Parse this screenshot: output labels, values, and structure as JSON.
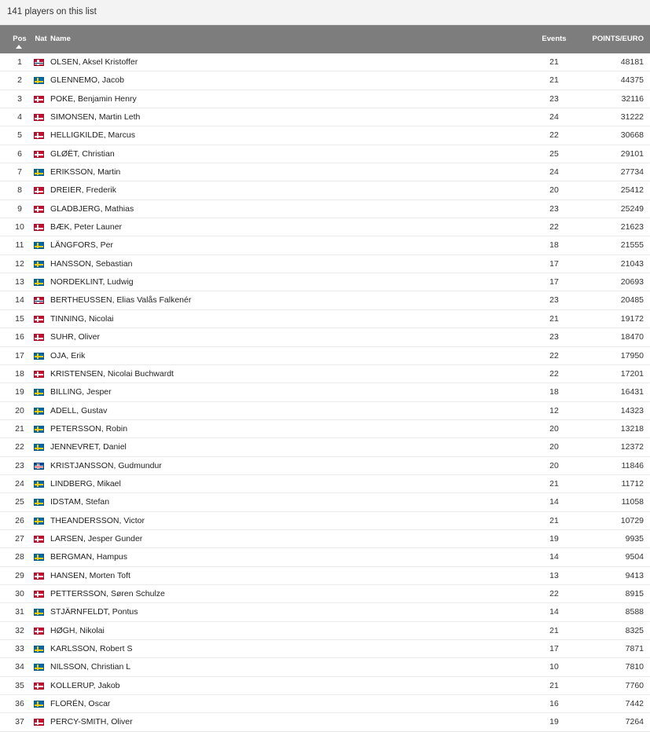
{
  "summary": "141 players on this list",
  "columns": {
    "pos": "Pos",
    "nat": "Nat",
    "name": "Name",
    "events": "Events",
    "points": "POINTS/EURO"
  },
  "sort": {
    "column": "pos",
    "direction": "ascending"
  },
  "flag_icons": {
    "DK": "denmark-flag-icon",
    "SE": "sweden-flag-icon",
    "NO": "norway-flag-icon",
    "IS": "iceland-flag-icon"
  },
  "rows": [
    {
      "pos": "1",
      "nat": "NO",
      "name": "OLSEN, Aksel Kristoffer",
      "events": "21",
      "points": "48181"
    },
    {
      "pos": "2",
      "nat": "SE",
      "name": "GLENNEMO, Jacob",
      "events": "21",
      "points": "44375"
    },
    {
      "pos": "3",
      "nat": "DK",
      "name": "POKE, Benjamin Henry",
      "events": "23",
      "points": "32116"
    },
    {
      "pos": "4",
      "nat": "DK",
      "name": "SIMONSEN, Martin Leth",
      "events": "24",
      "points": "31222"
    },
    {
      "pos": "5",
      "nat": "DK",
      "name": "HELLIGKILDE, Marcus",
      "events": "22",
      "points": "30668"
    },
    {
      "pos": "6",
      "nat": "DK",
      "name": "GLØËT, Christian",
      "events": "25",
      "points": "29101"
    },
    {
      "pos": "7",
      "nat": "SE",
      "name": "ERIKSSON, Martin",
      "events": "24",
      "points": "27734"
    },
    {
      "pos": "8",
      "nat": "DK",
      "name": "DREIER, Frederik",
      "events": "20",
      "points": "25412"
    },
    {
      "pos": "9",
      "nat": "DK",
      "name": "GLADBJERG, Mathias",
      "events": "23",
      "points": "25249"
    },
    {
      "pos": "10",
      "nat": "DK",
      "name": "BÆK, Peter Launer",
      "events": "22",
      "points": "21623"
    },
    {
      "pos": "11",
      "nat": "SE",
      "name": "LÄNGFORS, Per",
      "events": "18",
      "points": "21555"
    },
    {
      "pos": "12",
      "nat": "SE",
      "name": "HANSSON, Sebastian",
      "events": "17",
      "points": "21043"
    },
    {
      "pos": "13",
      "nat": "SE",
      "name": "NORDEKLINT, Ludwig",
      "events": "17",
      "points": "20693"
    },
    {
      "pos": "14",
      "nat": "NO",
      "name": "BERTHEUSSEN, Elias Valås Falkenér",
      "events": "23",
      "points": "20485"
    },
    {
      "pos": "15",
      "nat": "DK",
      "name": "TINNING, Nicolai",
      "events": "21",
      "points": "19172"
    },
    {
      "pos": "16",
      "nat": "DK",
      "name": "SUHR, Oliver",
      "events": "23",
      "points": "18470"
    },
    {
      "pos": "17",
      "nat": "SE",
      "name": "OJA, Erik",
      "events": "22",
      "points": "17950"
    },
    {
      "pos": "18",
      "nat": "DK",
      "name": "KRISTENSEN, Nicolai Buchwardt",
      "events": "22",
      "points": "17201"
    },
    {
      "pos": "19",
      "nat": "SE",
      "name": "BILLING, Jesper",
      "events": "18",
      "points": "16431"
    },
    {
      "pos": "20",
      "nat": "SE",
      "name": "ADELL, Gustav",
      "events": "12",
      "points": "14323"
    },
    {
      "pos": "21",
      "nat": "SE",
      "name": "PETERSSON, Robin",
      "events": "20",
      "points": "13218"
    },
    {
      "pos": "22",
      "nat": "SE",
      "name": "JENNEVRET, Daniel",
      "events": "20",
      "points": "12372"
    },
    {
      "pos": "23",
      "nat": "IS",
      "name": "KRISTJANSSON, Gudmundur",
      "events": "20",
      "points": "11846"
    },
    {
      "pos": "24",
      "nat": "SE",
      "name": "LINDBERG, Mikael",
      "events": "21",
      "points": "11712"
    },
    {
      "pos": "25",
      "nat": "SE",
      "name": "IDSTAM, Stefan",
      "events": "14",
      "points": "11058"
    },
    {
      "pos": "26",
      "nat": "SE",
      "name": "THEANDERSSON, Victor",
      "events": "21",
      "points": "10729"
    },
    {
      "pos": "27",
      "nat": "DK",
      "name": "LARSEN, Jesper Gunder",
      "events": "19",
      "points": "9935"
    },
    {
      "pos": "28",
      "nat": "SE",
      "name": "BERGMAN, Hampus",
      "events": "14",
      "points": "9504"
    },
    {
      "pos": "29",
      "nat": "DK",
      "name": "HANSEN, Morten Toft",
      "events": "13",
      "points": "9413"
    },
    {
      "pos": "30",
      "nat": "DK",
      "name": "PETTERSSON, Søren Schulze",
      "events": "22",
      "points": "8915"
    },
    {
      "pos": "31",
      "nat": "SE",
      "name": "STJÄRNFELDT, Pontus",
      "events": "14",
      "points": "8588"
    },
    {
      "pos": "32",
      "nat": "DK",
      "name": "HØGH, Nikolai",
      "events": "21",
      "points": "8325"
    },
    {
      "pos": "33",
      "nat": "SE",
      "name": "KARLSSON, Robert S",
      "events": "17",
      "points": "7871"
    },
    {
      "pos": "34",
      "nat": "SE",
      "name": "NILSSON, Christian L",
      "events": "10",
      "points": "7810"
    },
    {
      "pos": "35",
      "nat": "DK",
      "name": "KOLLERUP, Jakob",
      "events": "21",
      "points": "7760"
    },
    {
      "pos": "36",
      "nat": "SE",
      "name": "FLORÉN, Oscar",
      "events": "16",
      "points": "7442"
    },
    {
      "pos": "37",
      "nat": "DK",
      "name": "PERCY-SMITH, Oliver",
      "events": "19",
      "points": "7264"
    }
  ]
}
